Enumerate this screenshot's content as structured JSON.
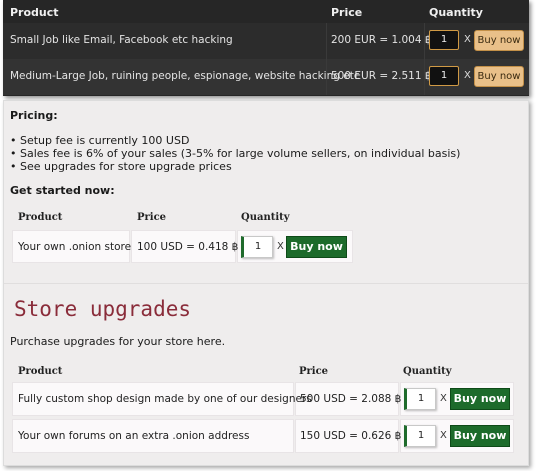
{
  "jobs_table": {
    "headers": {
      "product": "Product",
      "price": "Price",
      "quantity": "Quantity"
    },
    "rows": [
      {
        "product": "Small Job like Email, Facebook etc hacking",
        "price": "200 EUR = 1.004 ฿",
        "qty": "1",
        "x": "X",
        "buy": "Buy now"
      },
      {
        "product": "Medium-Large Job, ruining people, espionage, website hacking etc",
        "price": "500 EUR = 2.511 ฿",
        "qty": "1",
        "x": "X",
        "buy": "Buy now"
      }
    ]
  },
  "pricing": {
    "title": "Pricing:",
    "items": [
      "• Setup fee is currently 100 USD",
      "• Sales fee is 6% of your sales (3-5% for large volume sellers, on individual basis)",
      "• See upgrades for store upgrade prices"
    ]
  },
  "get_started": {
    "title": "Get started now:",
    "headers": {
      "product": "Product",
      "price": "Price",
      "quantity": "Quantity"
    },
    "row": {
      "product": "Your own .onion store",
      "price": "100 USD = 0.418 ฿",
      "qty": "1",
      "x": "X",
      "buy": "Buy now"
    }
  },
  "upgrades": {
    "title": "Store upgrades",
    "subtitle": "Purchase upgrades for your store here.",
    "headers": {
      "product": "Product",
      "price": "Price",
      "quantity": "Quantity"
    },
    "rows": [
      {
        "product": "Fully custom shop design made by one of our designers",
        "price": "500 USD = 2.088 ฿",
        "qty": "1",
        "x": "X",
        "buy": "Buy now"
      },
      {
        "product": "Your own forums on an extra .onion address",
        "price": "150 USD = 0.626 ฿",
        "qty": "1",
        "x": "X",
        "buy": "Buy now"
      }
    ]
  }
}
